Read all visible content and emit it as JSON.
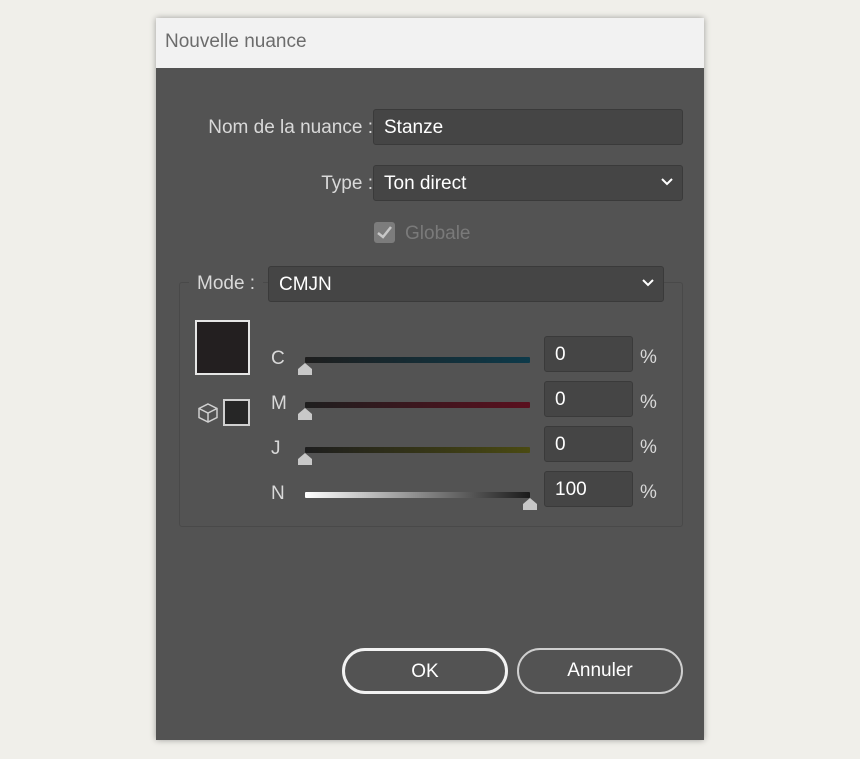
{
  "window": {
    "title": "Nouvelle nuance"
  },
  "form": {
    "name_label": "Nom de la nuance :",
    "name_value": "Stanze",
    "type_label": "Type :",
    "type_value": "Ton direct",
    "global_label": "Globale",
    "global_checked": true,
    "mode_label": "Mode :",
    "mode_value": "CMJN"
  },
  "swatch": {
    "color": "#231f20"
  },
  "sliders": [
    {
      "channel": "C",
      "value": "0",
      "unit": "%",
      "track_color": "#0d3a4a"
    },
    {
      "channel": "M",
      "value": "0",
      "unit": "%",
      "track_color": "#5a0f1e"
    },
    {
      "channel": "J",
      "value": "0",
      "unit": "%",
      "track_color": "#4a4a12"
    },
    {
      "channel": "N",
      "value": "100",
      "unit": "%",
      "track_color": "#ffffff"
    }
  ],
  "buttons": {
    "ok_label": "OK",
    "cancel_label": "Annuler"
  }
}
